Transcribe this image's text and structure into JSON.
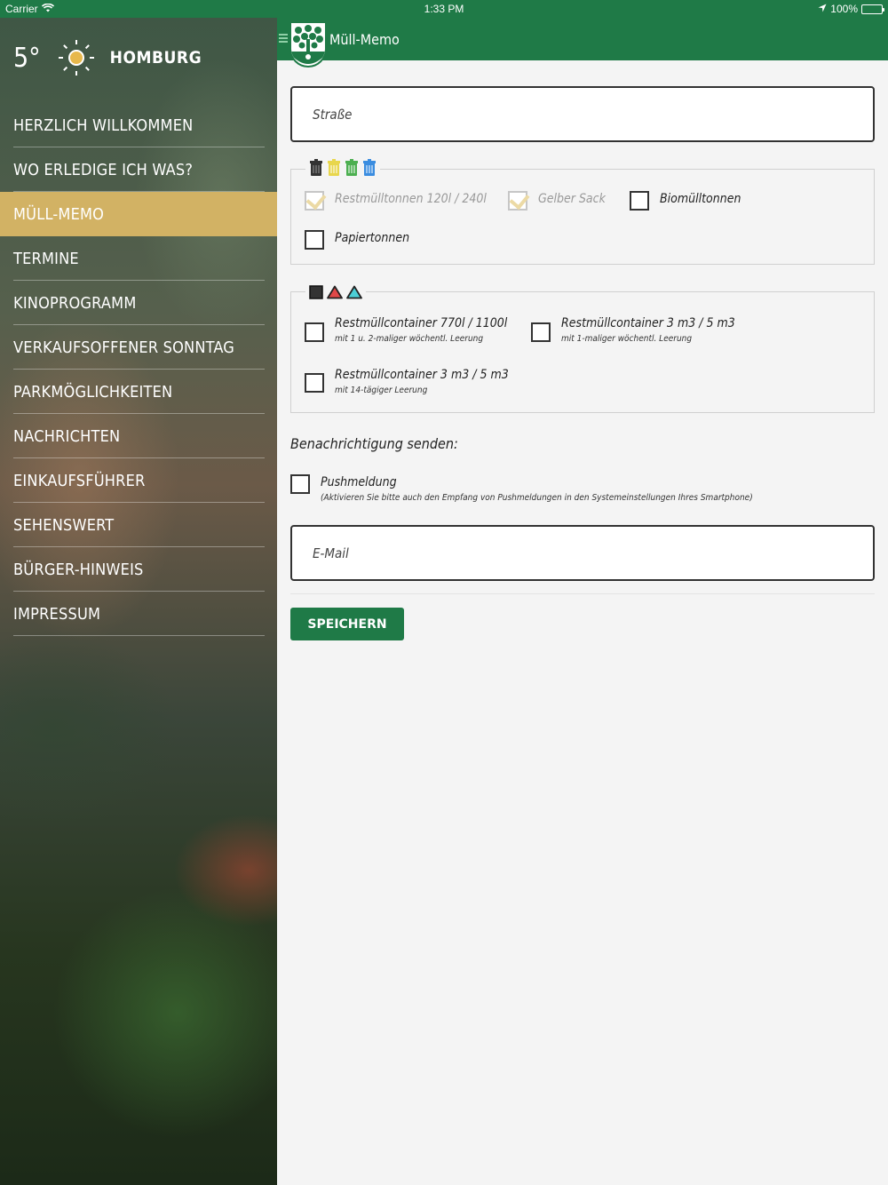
{
  "status_bar": {
    "carrier": "Carrier",
    "time": "1:33 PM",
    "battery": "100%"
  },
  "weather": {
    "temperature": "5°",
    "icon": "sun-icon",
    "city": "HOMBURG"
  },
  "menu": [
    {
      "label": "HERZLICH WILLKOMMEN"
    },
    {
      "label": "WO ERLEDIGE ICH WAS?"
    },
    {
      "label": "MÜLL-MEMO",
      "active": true
    },
    {
      "label": "TERMINE"
    },
    {
      "label": "KINOPROGRAMM"
    },
    {
      "label": "VERKAUFSOFFENER SONNTAG"
    },
    {
      "label": "PARKMÖGLICHKEITEN"
    },
    {
      "label": "NACHRICHTEN"
    },
    {
      "label": "EINKAUFSFÜHRER"
    },
    {
      "label": "SEHENSWERT"
    },
    {
      "label": "BÜRGER-HINWEIS"
    },
    {
      "label": "IMPRESSUM"
    }
  ],
  "header": {
    "title": "Müll-Memo"
  },
  "street": {
    "placeholder": "Straße",
    "value": ""
  },
  "bins": {
    "icons": [
      "black-bin-icon",
      "yellow-bin-icon",
      "green-bin-icon",
      "blue-bin-icon"
    ],
    "options": [
      {
        "label": "Restmülltonnen 120l / 240l",
        "checked": true,
        "disabled": true
      },
      {
        "label": "Gelber Sack",
        "checked": true,
        "disabled": true
      },
      {
        "label": "Biomülltonnen",
        "checked": false
      },
      {
        "label": "Papiertonnen",
        "checked": false
      }
    ]
  },
  "containers": {
    "icons": [
      "black-square-icon",
      "red-triangle-icon",
      "cyan-triangle-icon"
    ],
    "options": [
      {
        "label": "Restmüllcontainer 770l / 1100l",
        "sub": "mit 1 u. 2-maliger wöchentl. Leerung",
        "checked": false
      },
      {
        "label": "Restmüllcontainer 3 m3 / 5 m3",
        "sub": "mit 1-maliger wöchentl. Leerung",
        "checked": false
      },
      {
        "label": "Restmüllcontainer 3 m3 / 5 m3",
        "sub": "mit 14-tägiger Leerung",
        "checked": false
      }
    ]
  },
  "notification": {
    "label": "Benachrichtigung senden:",
    "push_label": "Pushmeldung",
    "push_hint": "(Aktivieren Sie bitte auch den Empfang von Pushmeldungen in den Systemeinstellungen Ihres Smartphone)"
  },
  "email": {
    "placeholder": "E-Mail",
    "value": ""
  },
  "save_label": "SPEICHERN",
  "colors": {
    "brand_green": "#1f7a47",
    "menu_active": "#d2b264",
    "check": "#ecdaa5"
  }
}
